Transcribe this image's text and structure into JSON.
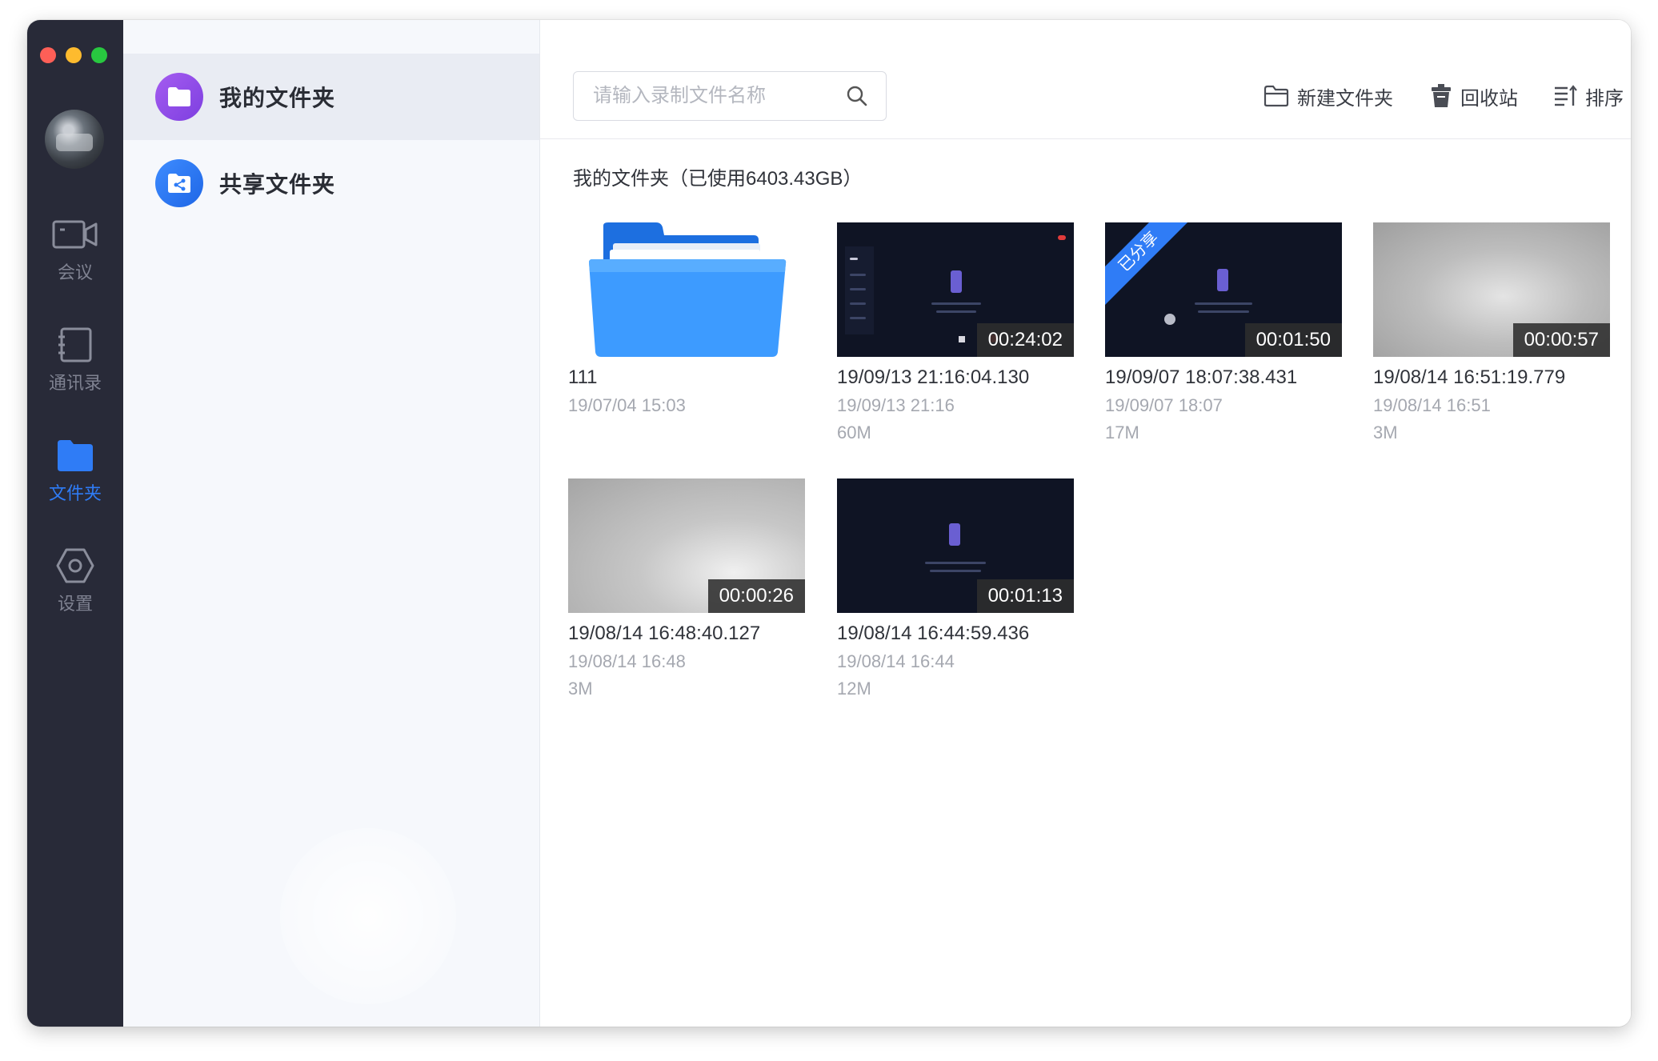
{
  "nav": {
    "items": [
      {
        "label": "会议",
        "icon": "video-camera-icon"
      },
      {
        "label": "通讯录",
        "icon": "address-book-icon"
      },
      {
        "label": "文件夹",
        "icon": "folder-icon",
        "active": true
      },
      {
        "label": "设置",
        "icon": "settings-hexagon-icon"
      }
    ]
  },
  "folders": [
    {
      "label": "我的文件夹",
      "color": "#8e44e6",
      "selected": true
    },
    {
      "label": "共享文件夹",
      "color": "#2f7cf6"
    }
  ],
  "toolbar": {
    "search_placeholder": "请输入录制文件名称",
    "new_folder": "新建文件夹",
    "recycle_bin": "回收站",
    "sort": "排序"
  },
  "section_title": "我的文件夹（已使用6403.43GB）",
  "items": [
    {
      "type": "folder",
      "name": "111",
      "date": "19/07/04 15:03"
    },
    {
      "type": "video",
      "name": "19/09/13 21:16:04.130",
      "date": "19/09/13 21:16",
      "size": "60M",
      "duration": "00:24:02",
      "thumb": "dark"
    },
    {
      "type": "video",
      "name": "19/09/07 18:07:38.431",
      "date": "19/09/07 18:07",
      "size": "17M",
      "duration": "00:01:50",
      "thumb": "dark",
      "shared_label": "已分享"
    },
    {
      "type": "video",
      "name": "19/08/14 16:51:19.779",
      "date": "19/08/14 16:51",
      "size": "3M",
      "duration": "00:00:57",
      "thumb": "gray"
    },
    {
      "type": "video",
      "name": "19/08/14 16:48:40.127",
      "date": "19/08/14 16:48",
      "size": "3M",
      "duration": "00:00:26",
      "thumb": "gray2"
    },
    {
      "type": "video",
      "name": "19/08/14 16:44:59.436",
      "date": "19/08/14 16:44",
      "size": "12M",
      "duration": "00:01:13",
      "thumb": "dark"
    }
  ],
  "colors": {
    "accent": "#2f7cf6",
    "nav_bg": "#282a38"
  }
}
